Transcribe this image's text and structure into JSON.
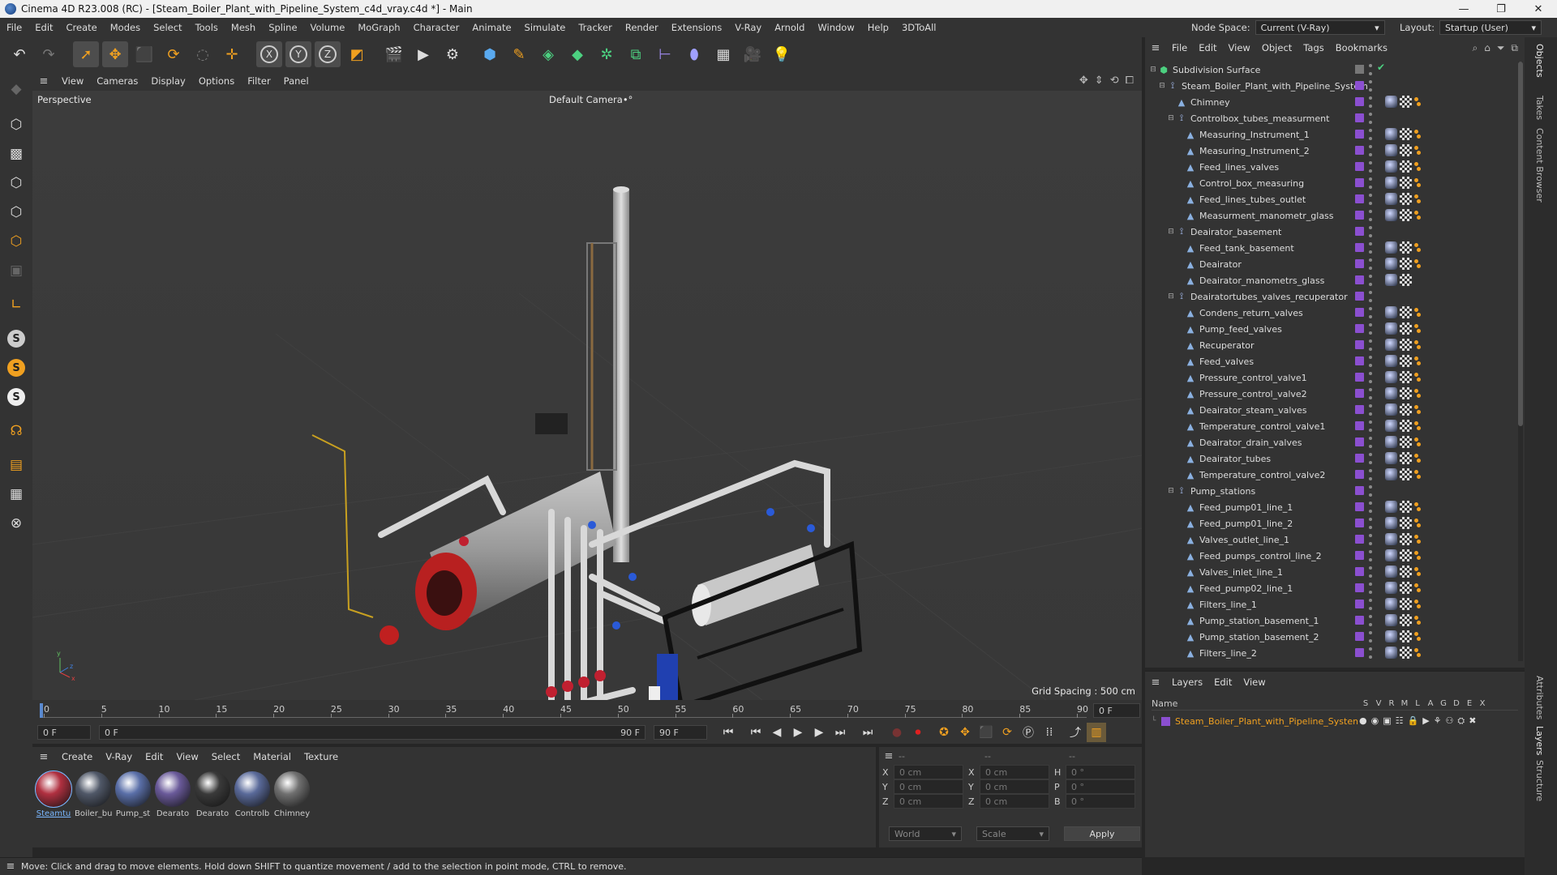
{
  "window": {
    "title": "Cinema 4D R23.008 (RC) - [Steam_Boiler_Plant_with_Pipeline_System_c4d_vray.c4d *] - Main",
    "min": "—",
    "max": "❐",
    "close": "✕"
  },
  "menubar": {
    "items": [
      "File",
      "Edit",
      "Create",
      "Modes",
      "Select",
      "Tools",
      "Mesh",
      "Spline",
      "Volume",
      "MoGraph",
      "Character",
      "Animate",
      "Simulate",
      "Tracker",
      "Render",
      "Extensions",
      "V-Ray",
      "Arnold",
      "Window",
      "Help",
      "3DToAll"
    ],
    "node_space_label": "Node Space:",
    "node_space_value": "Current (V-Ray)",
    "layout_label": "Layout:",
    "layout_value": "Startup (User)"
  },
  "viewport": {
    "menu": [
      "View",
      "Cameras",
      "Display",
      "Options",
      "Filter",
      "Panel"
    ],
    "label": "Perspective",
    "camera": "Default Camera",
    "camera_suffix": "•°",
    "grid_spacing": "Grid Spacing : 500 cm"
  },
  "timeline": {
    "ticks": [
      "0",
      "5",
      "10",
      "15",
      "20",
      "25",
      "30",
      "35",
      "40",
      "45",
      "50",
      "55",
      "60",
      "65",
      "70",
      "75",
      "80",
      "85",
      "90"
    ],
    "end_field": "0 F"
  },
  "playbar": {
    "start": "0 F",
    "current": "0 F",
    "range_end": "90 F",
    "end": "90 F"
  },
  "materials": {
    "menu": [
      "Create",
      "V-Ray",
      "Edit",
      "View",
      "Select",
      "Material",
      "Texture"
    ],
    "items": [
      {
        "label": "Steamtu",
        "color": "#b03040"
      },
      {
        "label": "Boiler_bu",
        "color": "#505868"
      },
      {
        "label": "Pump_st",
        "color": "#5a6fa8"
      },
      {
        "label": "Dearato",
        "color": "#6a5a9a"
      },
      {
        "label": "Dearato",
        "color": "#3a3a3a"
      },
      {
        "label": "Controlb",
        "color": "#5a6a9a"
      },
      {
        "label": "Chimney",
        "color": "#707070"
      }
    ]
  },
  "coords": {
    "header": [
      "--",
      "--",
      "--"
    ],
    "rows": [
      {
        "a": "X",
        "av": "0 cm",
        "b": "X",
        "bv": "0 cm",
        "c": "H",
        "cv": "0 °"
      },
      {
        "a": "Y",
        "av": "0 cm",
        "b": "Y",
        "bv": "0 cm",
        "c": "P",
        "cv": "0 °"
      },
      {
        "a": "Z",
        "av": "0 cm",
        "b": "Z",
        "bv": "0 cm",
        "c": "B",
        "cv": "0 °"
      }
    ],
    "space": "World",
    "mode": "Scale",
    "apply": "Apply"
  },
  "status": {
    "message": "Move: Click and drag to move elements. Hold down SHIFT to quantize movement / add to the selection in point mode, CTRL to remove."
  },
  "objects": {
    "menu": [
      "File",
      "Edit",
      "View",
      "Object",
      "Tags",
      "Bookmarks"
    ],
    "tree": [
      {
        "name": "Subdivision Surface",
        "depth": 0,
        "kind": "subdiv",
        "expand": "minus",
        "tags": "check"
      },
      {
        "name": "Steam_Boiler_Plant_with_Pipeline_System",
        "depth": 1,
        "kind": "null",
        "expand": "minus",
        "tags": ""
      },
      {
        "name": "Chimney",
        "depth": 2,
        "kind": "mesh",
        "expand": "",
        "tags": "full"
      },
      {
        "name": "Controlbox_tubes_measurment",
        "depth": 2,
        "kind": "null",
        "expand": "minus",
        "tags": ""
      },
      {
        "name": "Measuring_Instrument_1",
        "depth": 3,
        "kind": "mesh",
        "expand": "",
        "tags": "full"
      },
      {
        "name": "Measuring_Instrument_2",
        "depth": 3,
        "kind": "mesh",
        "expand": "",
        "tags": "full"
      },
      {
        "name": "Feed_lines_valves",
        "depth": 3,
        "kind": "mesh",
        "expand": "",
        "tags": "full"
      },
      {
        "name": "Control_box_measuring",
        "depth": 3,
        "kind": "mesh",
        "expand": "",
        "tags": "full"
      },
      {
        "name": "Feed_lines_tubes_outlet",
        "depth": 3,
        "kind": "mesh",
        "expand": "",
        "tags": "full"
      },
      {
        "name": "Measurment_manometr_glass",
        "depth": 3,
        "kind": "mesh",
        "expand": "",
        "tags": "full"
      },
      {
        "name": "Deairator_basement",
        "depth": 2,
        "kind": "null",
        "expand": "minus",
        "tags": ""
      },
      {
        "name": "Feed_tank_basement",
        "depth": 3,
        "kind": "mesh",
        "expand": "",
        "tags": "full"
      },
      {
        "name": "Deairator",
        "depth": 3,
        "kind": "mesh",
        "expand": "",
        "tags": "full"
      },
      {
        "name": "Deairator_manometrs_glass",
        "depth": 3,
        "kind": "mesh",
        "expand": "",
        "tags": "part"
      },
      {
        "name": "Deairatortubes_valves_recuperator",
        "depth": 2,
        "kind": "null",
        "expand": "minus",
        "tags": ""
      },
      {
        "name": "Condens_return_valves",
        "depth": 3,
        "kind": "mesh",
        "expand": "",
        "tags": "full"
      },
      {
        "name": "Pump_feed_valves",
        "depth": 3,
        "kind": "mesh",
        "expand": "",
        "tags": "full"
      },
      {
        "name": "Recuperator",
        "depth": 3,
        "kind": "mesh",
        "expand": "",
        "tags": "full"
      },
      {
        "name": "Feed_valves",
        "depth": 3,
        "kind": "mesh",
        "expand": "",
        "tags": "full"
      },
      {
        "name": "Pressure_control_valve1",
        "depth": 3,
        "kind": "mesh",
        "expand": "",
        "tags": "full"
      },
      {
        "name": "Pressure_control_valve2",
        "depth": 3,
        "kind": "mesh",
        "expand": "",
        "tags": "full"
      },
      {
        "name": "Deairator_steam_valves",
        "depth": 3,
        "kind": "mesh",
        "expand": "",
        "tags": "full"
      },
      {
        "name": "Temperature_control_valve1",
        "depth": 3,
        "kind": "mesh",
        "expand": "",
        "tags": "full"
      },
      {
        "name": "Deairator_drain_valves",
        "depth": 3,
        "kind": "mesh",
        "expand": "",
        "tags": "full"
      },
      {
        "name": "Deairator_tubes",
        "depth": 3,
        "kind": "mesh",
        "expand": "",
        "tags": "full"
      },
      {
        "name": "Temperature_control_valve2",
        "depth": 3,
        "kind": "mesh",
        "expand": "",
        "tags": "full"
      },
      {
        "name": "Pump_stations",
        "depth": 2,
        "kind": "null",
        "expand": "minus",
        "tags": ""
      },
      {
        "name": "Feed_pump01_line_1",
        "depth": 3,
        "kind": "mesh",
        "expand": "",
        "tags": "full"
      },
      {
        "name": "Feed_pump01_line_2",
        "depth": 3,
        "kind": "mesh",
        "expand": "",
        "tags": "full"
      },
      {
        "name": "Valves_outlet_line_1",
        "depth": 3,
        "kind": "mesh",
        "expand": "",
        "tags": "full"
      },
      {
        "name": "Feed_pumps_control_line_2",
        "depth": 3,
        "kind": "mesh",
        "expand": "",
        "tags": "full"
      },
      {
        "name": "Valves_inlet_line_1",
        "depth": 3,
        "kind": "mesh",
        "expand": "",
        "tags": "full"
      },
      {
        "name": "Feed_pump02_line_1",
        "depth": 3,
        "kind": "mesh",
        "expand": "",
        "tags": "full"
      },
      {
        "name": "Filters_line_1",
        "depth": 3,
        "kind": "mesh",
        "expand": "",
        "tags": "full"
      },
      {
        "name": "Pump_station_basement_1",
        "depth": 3,
        "kind": "mesh",
        "expand": "",
        "tags": "full"
      },
      {
        "name": "Pump_station_basement_2",
        "depth": 3,
        "kind": "mesh",
        "expand": "",
        "tags": "full"
      },
      {
        "name": "Filters_line_2",
        "depth": 3,
        "kind": "mesh",
        "expand": "",
        "tags": "full"
      }
    ]
  },
  "layers": {
    "menu": [
      "Layers",
      "Edit",
      "View"
    ],
    "col_name": "Name",
    "cols": [
      "S",
      "V",
      "R",
      "M",
      "L",
      "A",
      "G",
      "D",
      "E",
      "X"
    ],
    "row_name": "Steam_Boiler_Plant_with_Pipeline_System",
    "row_color": "#f0a020"
  },
  "side_tabs": [
    "Objects",
    "Takes",
    "Content Browser",
    "Attributes",
    "Layers",
    "Structure"
  ]
}
